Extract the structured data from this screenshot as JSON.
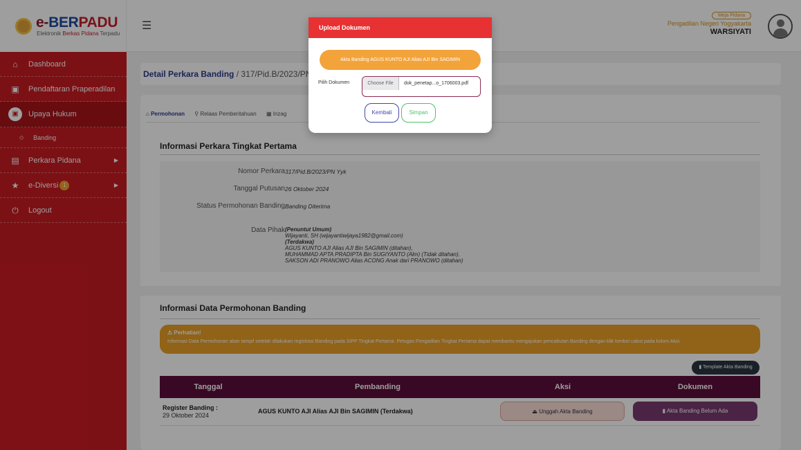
{
  "brand": {
    "title_e": "e-",
    "title_ber": "BER",
    "title_padu": "PADU",
    "sub_black": "Elektronik",
    "sub_red": "Berkas Pidana",
    "sub_rest": "Terpadu"
  },
  "user": {
    "role": "Meja Pidana",
    "court": "Pengadilan Negeri Yogyakarta",
    "name": "WARSIYATI"
  },
  "sidebar": {
    "items": [
      {
        "label": "Dashboard"
      },
      {
        "label": "Pendaftaran Praperadilan"
      },
      {
        "label": "Upaya Hukum"
      },
      {
        "label": "Banding"
      },
      {
        "label": "Perkara Pidana"
      },
      {
        "label": "e-Diversi",
        "badge": "1"
      },
      {
        "label": "Logout"
      }
    ]
  },
  "breadcrumb": {
    "title": "Detail Perkara Banding",
    "sep": " / ",
    "case": "317/Pid.B/2023/PN Y"
  },
  "tabs": [
    {
      "label": "Permohonan"
    },
    {
      "label": "Relaas Pemberitahuan"
    },
    {
      "label": "Inzag"
    }
  ],
  "info_perkara": {
    "title": "Informasi Perkara Tingkat Pertama",
    "rows": [
      {
        "label": "Nomor Perkara",
        "value": "317/Pid.B/2023/PN Yyk"
      },
      {
        "label": "Tanggal Putusan",
        "value": "26 Oktober 2024"
      },
      {
        "label": "Status Permohonan Banding",
        "value": "Banding Diterima"
      },
      {
        "label": "Data Pihak"
      }
    ],
    "pihak": [
      "(Penuntut Umum)",
      "Wijayanti, SH (wijayantiwijaya1982@gmail.com)",
      "(Terdakwa)",
      "AGUS KUNTO AJI Alias AJI Bin SAGIMIN (ditahan),",
      "MUHAMMAD APTA PRADIPTA Bin SUGIYANTO (Alm) (Tidak ditahan),",
      "SAKSON ADI PRANOWO Alias ACONG Anak dari PRANOWO (ditahan)"
    ]
  },
  "permohonan": {
    "title": "Informasi Data Permohonan Banding",
    "warning_title": "Perhatian!",
    "warning_text": "Informasi Data Permohonan akan tampil setelah dilakukan registrasi Banding pada SIPP Tingkat Pertama. Petugas Pengadilan Tingkat Pertama dapat membantu mengajukan pencabutan Banding dengan klik tombol cabut pada kolom Aksi.",
    "template_button": "Template Akta Banding",
    "columns": [
      "Tanggal",
      "Pembanding",
      "Aksi",
      "Dokumen"
    ],
    "row": {
      "register_label": "Register Banding :",
      "register_date": "29 Oktober 2024",
      "pembanding": "AGUS KUNTO AJI Alias AJI Bin SAGIMIN (Terdakwa)",
      "upload_button": "Unggah Akta Banding",
      "document_button": "Akta Banding Belum Ada"
    }
  },
  "modal": {
    "title": "Upload Dokumen",
    "document_name": "Akta Banding AGUS KUNTO AJI Alias AJI Bin SAGIMIN",
    "file_label": "Pilih Dokumen",
    "file_button": "Choose File",
    "file_name": "dok_penetap...o_1706003.pdf",
    "back_button": "Kembali",
    "save_button": "Simpan"
  },
  "colors": {
    "sidebar": "#c91c22",
    "modal_header": "#e83133",
    "table_header": "#5d0d3b",
    "warning": "#e8a128",
    "accent": "#2e3a8c"
  }
}
